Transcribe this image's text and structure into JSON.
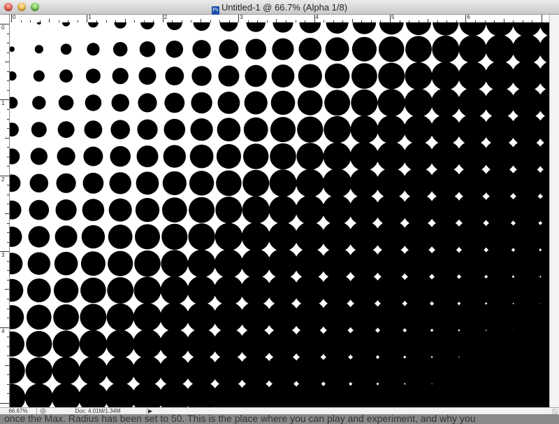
{
  "window": {
    "title": "Untitled-1 @ 66.7% (Alpha 1/8)",
    "app_icon": "photoshop-document-icon"
  },
  "rulers": {
    "horizontal_labels": [
      "0",
      "1",
      "2",
      "3",
      "4",
      "5",
      "6"
    ],
    "vertical_labels": [
      "0",
      "1",
      "2",
      "3",
      "4"
    ]
  },
  "status_bar": {
    "zoom": "66.67%",
    "doc_info": "Doc: 4.01M/1.34M",
    "menu_arrow": "▶"
  },
  "background_text": "once the Max. Radius has been set to 50. This is the place where you can play and experiment, and why you"
}
